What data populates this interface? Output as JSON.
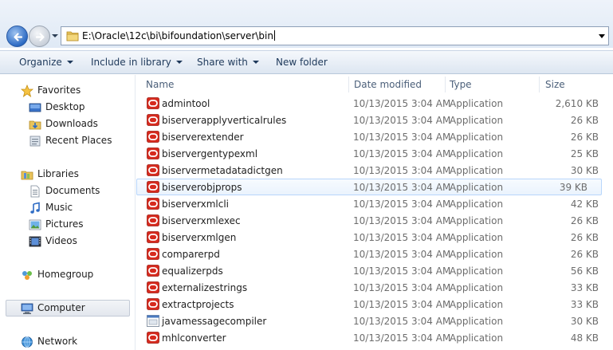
{
  "address": {
    "path": "E:\\Oracle\\12c\\bi\\bifoundation\\server\\bin"
  },
  "toolbar": {
    "organize": "Organize",
    "include_in_library": "Include in library",
    "share_with": "Share with",
    "new_folder": "New folder"
  },
  "nav": {
    "favorites": "Favorites",
    "desktop": "Desktop",
    "downloads": "Downloads",
    "recent_places": "Recent Places",
    "libraries": "Libraries",
    "documents": "Documents",
    "music": "Music",
    "pictures": "Pictures",
    "videos": "Videos",
    "homegroup": "Homegroup",
    "computer": "Computer",
    "network": "Network"
  },
  "columns": {
    "name": "Name",
    "date_modified": "Date modified",
    "type": "Type",
    "size": "Size"
  },
  "files": [
    {
      "name": "admintool",
      "date": "10/13/2015 3:04 AM",
      "type": "Application",
      "size": "2,610 KB",
      "icon": "oracle-app-icon"
    },
    {
      "name": "biserverapplyverticalrules",
      "date": "10/13/2015 3:04 AM",
      "type": "Application",
      "size": "26 KB",
      "icon": "oracle-app-icon"
    },
    {
      "name": "biserverextender",
      "date": "10/13/2015 3:04 AM",
      "type": "Application",
      "size": "26 KB",
      "icon": "oracle-app-icon"
    },
    {
      "name": "biservergentypexml",
      "date": "10/13/2015 3:04 AM",
      "type": "Application",
      "size": "25 KB",
      "icon": "oracle-app-icon"
    },
    {
      "name": "biservermetadatadictgen",
      "date": "10/13/2015 3:04 AM",
      "type": "Application",
      "size": "30 KB",
      "icon": "oracle-app-icon"
    },
    {
      "name": "biserverobjprops",
      "date": "10/13/2015 3:04 AM",
      "type": "Application",
      "size": "39 KB",
      "icon": "oracle-app-icon"
    },
    {
      "name": "biserverxmlcli",
      "date": "10/13/2015 3:04 AM",
      "type": "Application",
      "size": "42 KB",
      "icon": "oracle-app-icon"
    },
    {
      "name": "biserverxmlexec",
      "date": "10/13/2015 3:04 AM",
      "type": "Application",
      "size": "26 KB",
      "icon": "oracle-app-icon"
    },
    {
      "name": "biserverxmlgen",
      "date": "10/13/2015 3:04 AM",
      "type": "Application",
      "size": "26 KB",
      "icon": "oracle-app-icon"
    },
    {
      "name": "comparerpd",
      "date": "10/13/2015 3:04 AM",
      "type": "Application",
      "size": "26 KB",
      "icon": "oracle-app-icon"
    },
    {
      "name": "equalizerpds",
      "date": "10/13/2015 3:04 AM",
      "type": "Application",
      "size": "56 KB",
      "icon": "oracle-app-icon"
    },
    {
      "name": "externalizestrings",
      "date": "10/13/2015 3:04 AM",
      "type": "Application",
      "size": "33 KB",
      "icon": "oracle-app-icon"
    },
    {
      "name": "extractprojects",
      "date": "10/13/2015 3:04 AM",
      "type": "Application",
      "size": "33 KB",
      "icon": "oracle-app-icon"
    },
    {
      "name": "javamessagecompiler",
      "date": "10/13/2015 3:04 AM",
      "type": "Application",
      "size": "30 KB",
      "icon": "generic-app-icon"
    },
    {
      "name": "mhlconverter",
      "date": "10/13/2015 3:04 AM",
      "type": "Application",
      "size": "48 KB",
      "icon": "oracle-app-icon"
    }
  ],
  "state": {
    "hovered_row": "biserverobjprops",
    "selected_nav": "Computer"
  },
  "colors": {
    "accent_oracle_red": "#d62a1e",
    "hover_border": "#b8d6fb",
    "command_text": "#1e395b"
  }
}
